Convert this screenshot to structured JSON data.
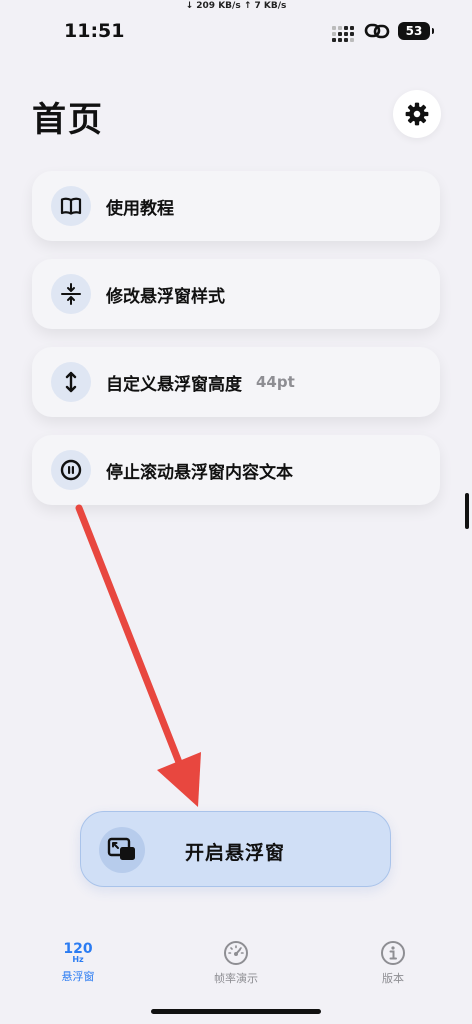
{
  "status_bar": {
    "network_speed": "↓ 209 KB/s   ↑ 7 KB/s",
    "time": "11:51",
    "battery": "53"
  },
  "header": {
    "title": "首页",
    "settings_icon": "gear-icon"
  },
  "menu": {
    "items": [
      {
        "label": "使用教程",
        "icon": "book-icon"
      },
      {
        "label": "修改悬浮窗样式",
        "icon": "compress-icon"
      },
      {
        "label": "自定义悬浮窗高度",
        "value": "44pt",
        "icon": "vertical-arrows-icon"
      },
      {
        "label": "停止滚动悬浮窗内容文本",
        "icon": "pause-icon"
      }
    ]
  },
  "start_button": {
    "label": "开启悬浮窗",
    "icon": "picture-in-picture-icon"
  },
  "tabs": [
    {
      "label": "悬浮窗",
      "icon_num": "120",
      "icon_unit": "Hz",
      "active": true
    },
    {
      "label": "帧率演示",
      "icon": "speedometer-icon",
      "active": false
    },
    {
      "label": "版本",
      "icon": "info-icon",
      "active": false
    }
  ],
  "colors": {
    "accent": "#2b7cf2",
    "inactive": "#8e8e93",
    "annotation_arrow": "#e8473f",
    "background": "#f2f1f6"
  }
}
